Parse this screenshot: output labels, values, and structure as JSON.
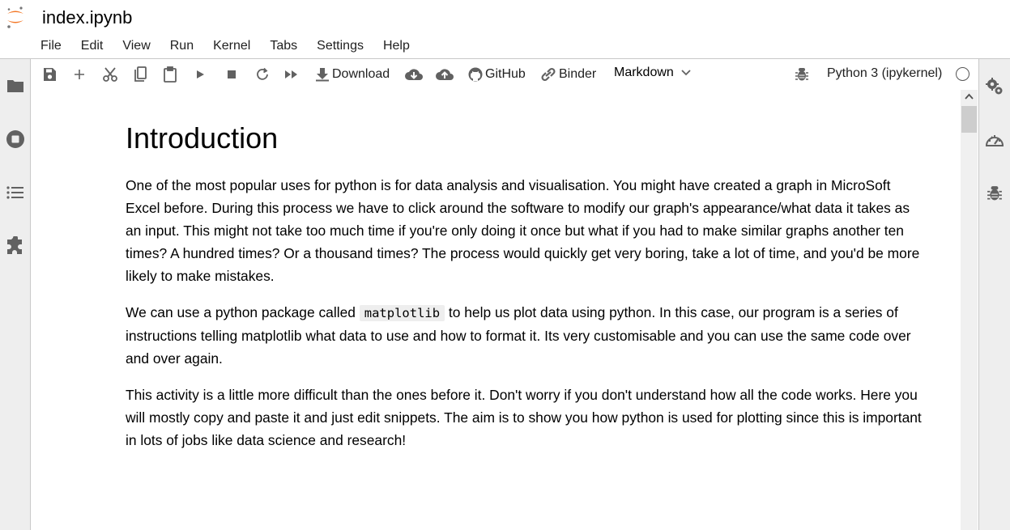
{
  "document": {
    "title": "index.ipynb"
  },
  "menu": [
    "File",
    "Edit",
    "View",
    "Run",
    "Kernel",
    "Tabs",
    "Settings",
    "Help"
  ],
  "toolbar": {
    "download_label": "Download",
    "github_label": "GitHub",
    "binder_label": "Binder",
    "cell_type": "Markdown",
    "kernel_name": "Python 3 (ipykernel)",
    "icons": [
      "save-icon",
      "add-icon",
      "cut-icon",
      "copy-icon",
      "paste-icon",
      "run-icon",
      "stop-icon",
      "restart-icon",
      "fast-forward-icon",
      "download-icon",
      "cloud-download-icon",
      "cloud-upload-icon",
      "github-icon",
      "link-icon",
      "chevron-down-icon",
      "bug-icon",
      "kernel-status-circle"
    ]
  },
  "left_sidebar": [
    "folder-icon",
    "running-icon",
    "toc-icon",
    "extension-icon"
  ],
  "right_sidebar": [
    "property-inspector-icon",
    "resource-gauge-icon",
    "debugger-icon"
  ],
  "cell": {
    "heading": "Introduction",
    "p1": "One of the most popular uses for python is for data analysis and visualisation. You might have created a graph in MicroSoft Excel before. During this process we have to click around the software to modify our graph's appearance/what data it takes as an input. This might not take too much time if you're only doing it once but what if you had to make similar graphs another ten times? A hundred times? Or a thousand times? The process would quickly get very boring, take a lot of time, and you'd be more likely to make mistakes.",
    "p2_before": "We can use a python package called ",
    "p2_code": "matplotlib",
    "p2_after": " to help us plot data using python. In this case, our program is a series of instructions telling matplotlib what data to use and how to format it. Its very customisable and you can use the same code over and over again.",
    "p3": "This activity is a little more difficult than the ones before it. Don't worry if you don't understand how all the code works. Here you will mostly copy and paste it and just edit snippets. The aim is to show you how python is used for plotting since this is important in lots of jobs like data science and research!"
  },
  "colors": {
    "jupyter_orange": "#f37726",
    "sidebar_bg": "#eeeeee",
    "icon_gray": "#616161"
  }
}
